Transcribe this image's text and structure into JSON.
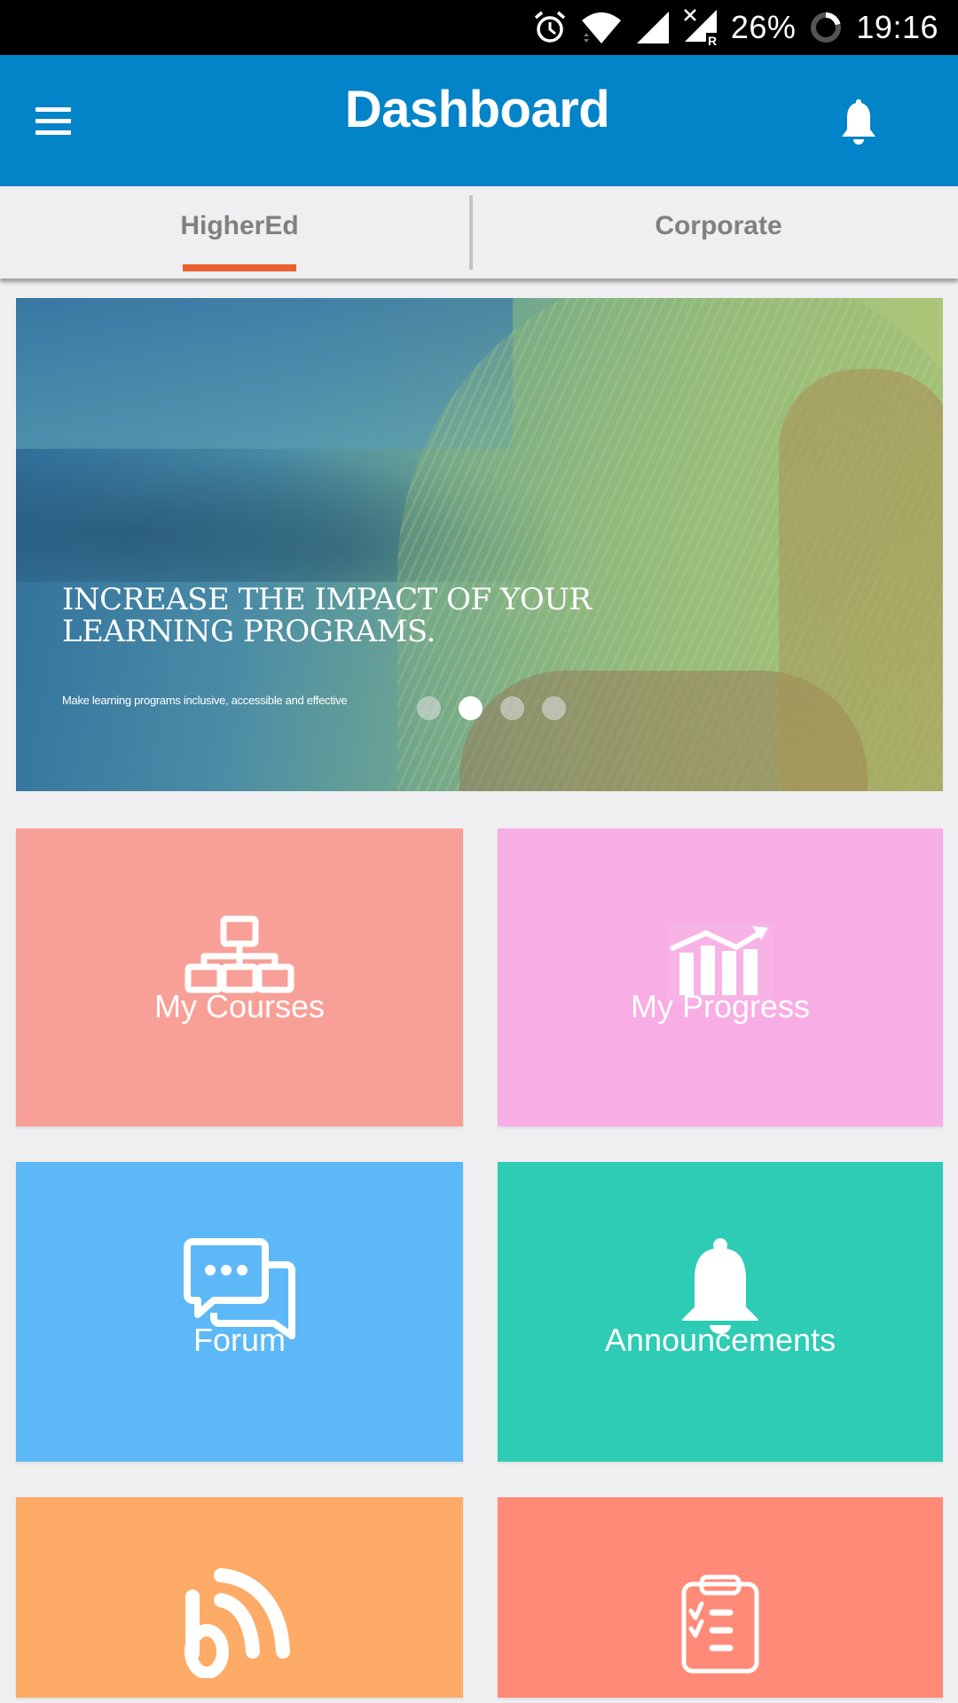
{
  "status_bar": {
    "icons": [
      "alarm-icon",
      "wifi-icon",
      "signal-icon",
      "signal-roaming-no-data-icon",
      "battery-ring-icon"
    ],
    "battery_percent": "26%",
    "battery_level": 0.26,
    "time": "19:16"
  },
  "app_bar": {
    "menu_icon": "hamburger-menu-icon",
    "title": "Dashboard",
    "notification_icon": "bell-icon",
    "background_color": "#0383c8"
  },
  "tabs": [
    {
      "label": "HigherEd",
      "active": true
    },
    {
      "label": "Corporate",
      "active": false
    }
  ],
  "tab_indicator_color": "#e8612c",
  "banner": {
    "headline_line1": "INCREASE THE IMPACT OF YOUR",
    "headline_line2": "LEARNING PROGRAMS.",
    "subline": "Make learning programs inclusive, accessible and effective",
    "slide_count": 4,
    "active_slide": 2
  },
  "tiles": [
    {
      "label": "My Courses",
      "icon": "sitemap-icon",
      "color": "#f8a097"
    },
    {
      "label": "My Progress",
      "icon": "chart-trending-up-icon",
      "color": "#f8ade4"
    },
    {
      "label": "Forum",
      "icon": "chat-bubbles-icon",
      "color": "#5db8f7"
    },
    {
      "label": "Announcements",
      "icon": "bell-icon",
      "color": "#2ecbb5"
    },
    {
      "label": "",
      "icon": "blog-rss-icon",
      "color": "#fdab67"
    },
    {
      "label": "",
      "icon": "clipboard-checklist-icon",
      "color": "#ff8a78"
    }
  ]
}
